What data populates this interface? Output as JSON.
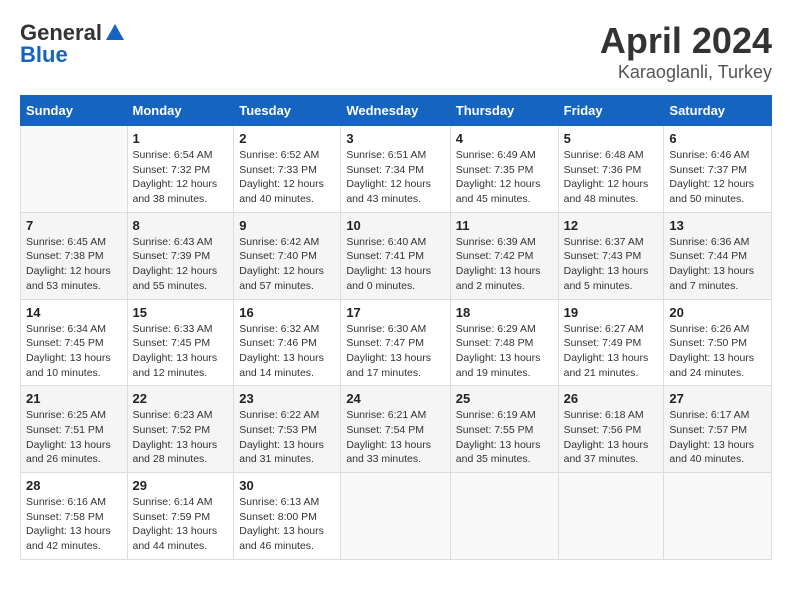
{
  "header": {
    "logo_general": "General",
    "logo_blue": "Blue",
    "month": "April 2024",
    "location": "Karaoglanli, Turkey"
  },
  "weekdays": [
    "Sunday",
    "Monday",
    "Tuesday",
    "Wednesday",
    "Thursday",
    "Friday",
    "Saturday"
  ],
  "weeks": [
    [
      {
        "day": "",
        "sunrise": "",
        "sunset": "",
        "daylight": ""
      },
      {
        "day": "1",
        "sunrise": "Sunrise: 6:54 AM",
        "sunset": "Sunset: 7:32 PM",
        "daylight": "Daylight: 12 hours and 38 minutes."
      },
      {
        "day": "2",
        "sunrise": "Sunrise: 6:52 AM",
        "sunset": "Sunset: 7:33 PM",
        "daylight": "Daylight: 12 hours and 40 minutes."
      },
      {
        "day": "3",
        "sunrise": "Sunrise: 6:51 AM",
        "sunset": "Sunset: 7:34 PM",
        "daylight": "Daylight: 12 hours and 43 minutes."
      },
      {
        "day": "4",
        "sunrise": "Sunrise: 6:49 AM",
        "sunset": "Sunset: 7:35 PM",
        "daylight": "Daylight: 12 hours and 45 minutes."
      },
      {
        "day": "5",
        "sunrise": "Sunrise: 6:48 AM",
        "sunset": "Sunset: 7:36 PM",
        "daylight": "Daylight: 12 hours and 48 minutes."
      },
      {
        "day": "6",
        "sunrise": "Sunrise: 6:46 AM",
        "sunset": "Sunset: 7:37 PM",
        "daylight": "Daylight: 12 hours and 50 minutes."
      }
    ],
    [
      {
        "day": "7",
        "sunrise": "Sunrise: 6:45 AM",
        "sunset": "Sunset: 7:38 PM",
        "daylight": "Daylight: 12 hours and 53 minutes."
      },
      {
        "day": "8",
        "sunrise": "Sunrise: 6:43 AM",
        "sunset": "Sunset: 7:39 PM",
        "daylight": "Daylight: 12 hours and 55 minutes."
      },
      {
        "day": "9",
        "sunrise": "Sunrise: 6:42 AM",
        "sunset": "Sunset: 7:40 PM",
        "daylight": "Daylight: 12 hours and 57 minutes."
      },
      {
        "day": "10",
        "sunrise": "Sunrise: 6:40 AM",
        "sunset": "Sunset: 7:41 PM",
        "daylight": "Daylight: 13 hours and 0 minutes."
      },
      {
        "day": "11",
        "sunrise": "Sunrise: 6:39 AM",
        "sunset": "Sunset: 7:42 PM",
        "daylight": "Daylight: 13 hours and 2 minutes."
      },
      {
        "day": "12",
        "sunrise": "Sunrise: 6:37 AM",
        "sunset": "Sunset: 7:43 PM",
        "daylight": "Daylight: 13 hours and 5 minutes."
      },
      {
        "day": "13",
        "sunrise": "Sunrise: 6:36 AM",
        "sunset": "Sunset: 7:44 PM",
        "daylight": "Daylight: 13 hours and 7 minutes."
      }
    ],
    [
      {
        "day": "14",
        "sunrise": "Sunrise: 6:34 AM",
        "sunset": "Sunset: 7:45 PM",
        "daylight": "Daylight: 13 hours and 10 minutes."
      },
      {
        "day": "15",
        "sunrise": "Sunrise: 6:33 AM",
        "sunset": "Sunset: 7:45 PM",
        "daylight": "Daylight: 13 hours and 12 minutes."
      },
      {
        "day": "16",
        "sunrise": "Sunrise: 6:32 AM",
        "sunset": "Sunset: 7:46 PM",
        "daylight": "Daylight: 13 hours and 14 minutes."
      },
      {
        "day": "17",
        "sunrise": "Sunrise: 6:30 AM",
        "sunset": "Sunset: 7:47 PM",
        "daylight": "Daylight: 13 hours and 17 minutes."
      },
      {
        "day": "18",
        "sunrise": "Sunrise: 6:29 AM",
        "sunset": "Sunset: 7:48 PM",
        "daylight": "Daylight: 13 hours and 19 minutes."
      },
      {
        "day": "19",
        "sunrise": "Sunrise: 6:27 AM",
        "sunset": "Sunset: 7:49 PM",
        "daylight": "Daylight: 13 hours and 21 minutes."
      },
      {
        "day": "20",
        "sunrise": "Sunrise: 6:26 AM",
        "sunset": "Sunset: 7:50 PM",
        "daylight": "Daylight: 13 hours and 24 minutes."
      }
    ],
    [
      {
        "day": "21",
        "sunrise": "Sunrise: 6:25 AM",
        "sunset": "Sunset: 7:51 PM",
        "daylight": "Daylight: 13 hours and 26 minutes."
      },
      {
        "day": "22",
        "sunrise": "Sunrise: 6:23 AM",
        "sunset": "Sunset: 7:52 PM",
        "daylight": "Daylight: 13 hours and 28 minutes."
      },
      {
        "day": "23",
        "sunrise": "Sunrise: 6:22 AM",
        "sunset": "Sunset: 7:53 PM",
        "daylight": "Daylight: 13 hours and 31 minutes."
      },
      {
        "day": "24",
        "sunrise": "Sunrise: 6:21 AM",
        "sunset": "Sunset: 7:54 PM",
        "daylight": "Daylight: 13 hours and 33 minutes."
      },
      {
        "day": "25",
        "sunrise": "Sunrise: 6:19 AM",
        "sunset": "Sunset: 7:55 PM",
        "daylight": "Daylight: 13 hours and 35 minutes."
      },
      {
        "day": "26",
        "sunrise": "Sunrise: 6:18 AM",
        "sunset": "Sunset: 7:56 PM",
        "daylight": "Daylight: 13 hours and 37 minutes."
      },
      {
        "day": "27",
        "sunrise": "Sunrise: 6:17 AM",
        "sunset": "Sunset: 7:57 PM",
        "daylight": "Daylight: 13 hours and 40 minutes."
      }
    ],
    [
      {
        "day": "28",
        "sunrise": "Sunrise: 6:16 AM",
        "sunset": "Sunset: 7:58 PM",
        "daylight": "Daylight: 13 hours and 42 minutes."
      },
      {
        "day": "29",
        "sunrise": "Sunrise: 6:14 AM",
        "sunset": "Sunset: 7:59 PM",
        "daylight": "Daylight: 13 hours and 44 minutes."
      },
      {
        "day": "30",
        "sunrise": "Sunrise: 6:13 AM",
        "sunset": "Sunset: 8:00 PM",
        "daylight": "Daylight: 13 hours and 46 minutes."
      },
      {
        "day": "",
        "sunrise": "",
        "sunset": "",
        "daylight": ""
      },
      {
        "day": "",
        "sunrise": "",
        "sunset": "",
        "daylight": ""
      },
      {
        "day": "",
        "sunrise": "",
        "sunset": "",
        "daylight": ""
      },
      {
        "day": "",
        "sunrise": "",
        "sunset": "",
        "daylight": ""
      }
    ]
  ]
}
